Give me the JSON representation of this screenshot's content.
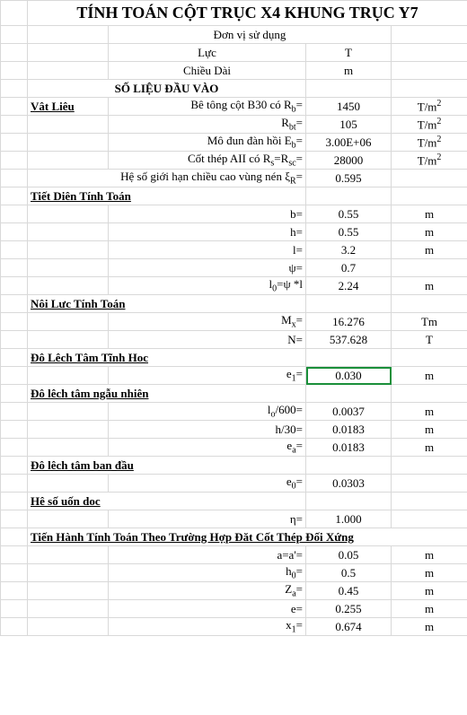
{
  "title": "TÍNH TOÁN CỘT TRỤC X4 KHUNG TRỤC Y7",
  "unit_header": "Đơn vị sử dụng",
  "force_label": "Lực",
  "force_unit": "T",
  "length_label": "Chiều Dài",
  "length_unit": "m",
  "section_input": "SỐ LIỆU ĐẦU VÀO",
  "material_label": "Vât Liêu",
  "rb_label_pre": "Bê tông cột B30 có R",
  "rb_sub": "b",
  "rb_eq": "=",
  "rb_val": "1450",
  "rb_unit_pre": "T/m",
  "rb_unit_sup": "2",
  "rbt_label_pre": "R",
  "rbt_sub": "bt",
  "rbt_eq": "=",
  "rbt_val": "105",
  "eb_label_pre": "Mô đun đàn hồi E",
  "eb_sub": "b",
  "eb_eq": "=",
  "eb_val": "3.00E+06",
  "steel_label_pre": "Cốt thép AII có R",
  "steel_sub1": "s",
  "steel_mid": "=R",
  "steel_sub2": "sc",
  "steel_eq": "=",
  "steel_val": "28000",
  "xi_label_pre": "Hệ số giới hạn chiều cao vùng nén ξ",
  "xi_sub": "R",
  "xi_eq": "=",
  "xi_val": "0.595",
  "section_cs": "Tiết Diên Tính Toán",
  "b_lab": "b=",
  "b_val": "0.55",
  "h_lab": "h=",
  "h_val": "0.55",
  "l_lab": "l=",
  "l_val": "3.2",
  "psi_lab": "ψ=",
  "psi_val": "0.7",
  "l0_lab_pre": "l",
  "l0_sub": "0",
  "l0_lab_post": "=ψ *l",
  "l0_val": "2.24",
  "section_force": "Nôi Lưc Tính Toán",
  "mx_lab_pre": "M",
  "mx_sub": "x",
  "mx_eq": "=",
  "mx_val": "16.276",
  "mx_unit": "Tm",
  "n_lab": "N=",
  "n_val": "537.628",
  "n_unit": "T",
  "section_e1": "Đô Lêch Tâm Tĩnh Hoc",
  "e1_lab_pre": "e",
  "e1_sub": "1",
  "e1_eq": "=",
  "e1_val": "0.030",
  "section_ea": "Đô lêch tâm ngẫu nhiên",
  "lo600_lab_pre": "l",
  "lo600_sub": "o",
  "lo600_lab_post": "/600=",
  "lo600_val": "0.0037",
  "h30_lab": "h/30=",
  "h30_val": "0.0183",
  "ea_lab_pre": "e",
  "ea_sub": "a",
  "ea_eq": "=",
  "ea_val": "0.0183",
  "section_e0": "Đô lêch tâm ban đầu",
  "e0_lab_pre": "e",
  "e0_sub": "0",
  "e0_eq": "=",
  "e0_val": "0.0303",
  "section_eta": "Hê số uốn doc",
  "eta_lab": "η=",
  "eta_val": "1.000",
  "section_calc": "Tiến Hành Tính Toán Theo Trường Hợp Đăt Cốt Thép Đối Xứng",
  "aa_lab": "a=a'=",
  "aa_val": "0.05",
  "h0_lab_pre": "h",
  "h0_sub": "0",
  "h0_eq": "=",
  "h0_val": "0.5",
  "za_lab_pre": "Z",
  "za_sub": "a",
  "za_eq": "=",
  "za_val": "0.45",
  "e_lab": "e=",
  "e_val": "0.255",
  "x1_lab_pre": "x",
  "x1_sub": "1",
  "x1_eq": "=",
  "x1_val": "0.674",
  "u_m": "m",
  "u_tm2_pre": "T/m",
  "u_tm2_sup": "2"
}
